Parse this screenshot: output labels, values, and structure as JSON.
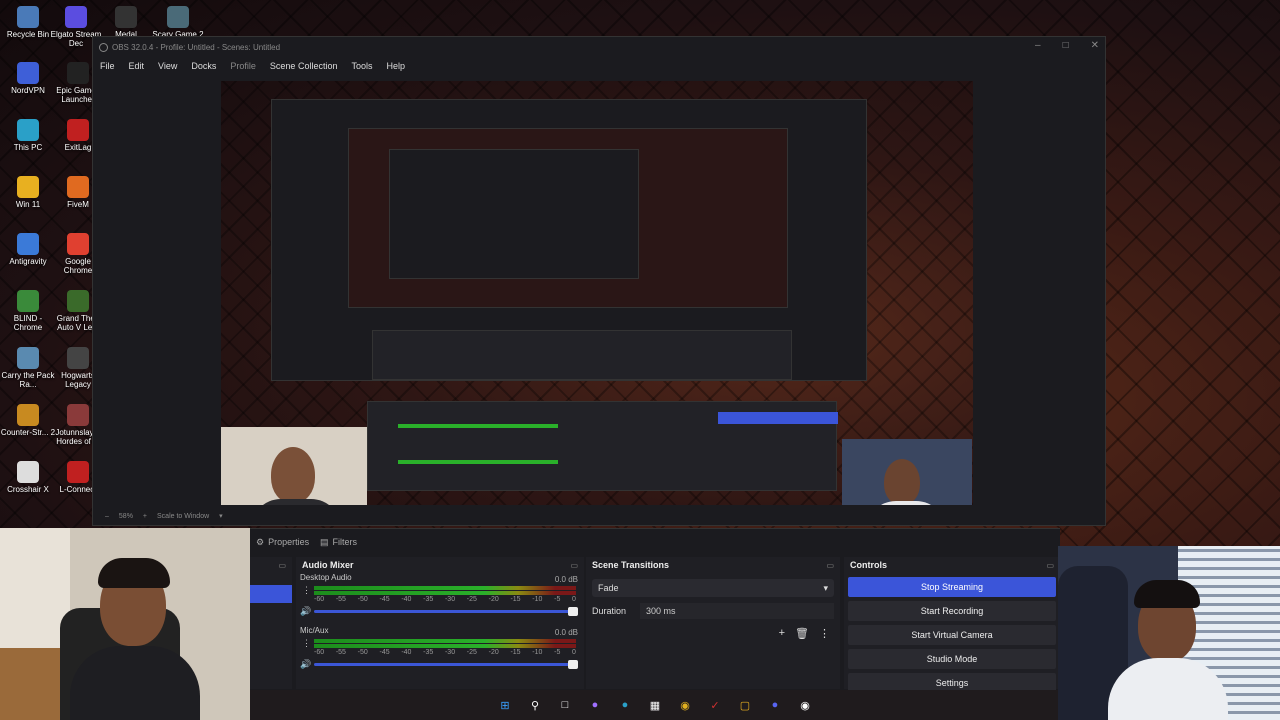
{
  "desktop": {
    "icons": [
      {
        "label": "Recycle Bin",
        "icon": "recycle-bin-icon",
        "color": "#4a7ab8"
      },
      {
        "label": "Elgato Stream Dec",
        "icon": "stream-deck-icon",
        "color": "#5b4de0"
      },
      {
        "label": "Medal",
        "icon": "medal-icon",
        "color": "#333333"
      },
      {
        "label": "Scary Game 2",
        "icon": "game-icon",
        "color": "#4a6a78"
      },
      {
        "label": "NordVPN",
        "icon": "nordvpn-icon",
        "color": "#3e5fd8"
      },
      {
        "label": "Epic Games Launcher",
        "icon": "epic-games-icon",
        "color": "#222222"
      },
      {
        "label": "This PC",
        "icon": "pc-icon",
        "color": "#2aa0c8"
      },
      {
        "label": "ExitLag",
        "icon": "exitlag-icon",
        "color": "#c02020"
      },
      {
        "label": "Win 11",
        "icon": "folder-icon",
        "color": "#e8b020"
      },
      {
        "label": "FiveM",
        "icon": "fivem-icon",
        "color": "#e06a20"
      },
      {
        "label": "Antigravity",
        "icon": "antigravity-icon",
        "color": "#3b7ad8"
      },
      {
        "label": "Google Chrome",
        "icon": "chrome-icon",
        "color": "#e04030"
      },
      {
        "label": "BLIND - Chrome",
        "icon": "chrome-icon",
        "color": "#3a8a3a"
      },
      {
        "label": "Grand Theft Auto V Le...",
        "icon": "gta-icon",
        "color": "#3a6a2a"
      },
      {
        "label": "Carry the Pack Ra...",
        "icon": "game-icon",
        "color": "#5a8ab0"
      },
      {
        "label": "Hogwarts Legacy",
        "icon": "hogwarts-icon",
        "color": "#444444"
      },
      {
        "label": "Counter-Str... 2",
        "icon": "cs2-icon",
        "color": "#c88a20"
      },
      {
        "label": "Jotunnslayer Hordes of ...",
        "icon": "game-icon",
        "color": "#8a3a3a"
      },
      {
        "label": "Crosshair X",
        "icon": "crosshair-icon",
        "color": "#dddddd"
      },
      {
        "label": "L-Connect",
        "icon": "lconnect-icon",
        "color": "#c02020"
      }
    ]
  },
  "obs": {
    "title": "OBS 32.0.4 - Profile: Untitled - Scenes: Untitled",
    "menu": [
      "File",
      "Edit",
      "View",
      "Docks",
      "Profile",
      "Scene Collection",
      "Tools",
      "Help"
    ],
    "zoom": "58%",
    "scale_mode": "Scale to Window",
    "tabs": {
      "properties": "Properties",
      "filters": "Filters"
    },
    "audio_mixer": {
      "title": "Audio Mixer",
      "channels": [
        {
          "name": "Desktop Audio",
          "db": "0.0 dB"
        },
        {
          "name": "Mic/Aux",
          "db": "0.0 dB"
        }
      ],
      "ticks": [
        "-60",
        "-55",
        "-50",
        "-45",
        "-40",
        "-35",
        "-30",
        "-25",
        "-20",
        "-15",
        "-10",
        "-5",
        "0"
      ]
    },
    "scene_transitions": {
      "title": "Scene Transitions",
      "transition": "Fade",
      "duration_label": "Duration",
      "duration_value": "300 ms"
    },
    "controls": {
      "title": "Controls",
      "buttons": [
        "Stop Streaming",
        "Start Recording",
        "Start Virtual Camera",
        "Studio Mode",
        "Settings"
      ],
      "active_color": "#3b55d9"
    }
  }
}
